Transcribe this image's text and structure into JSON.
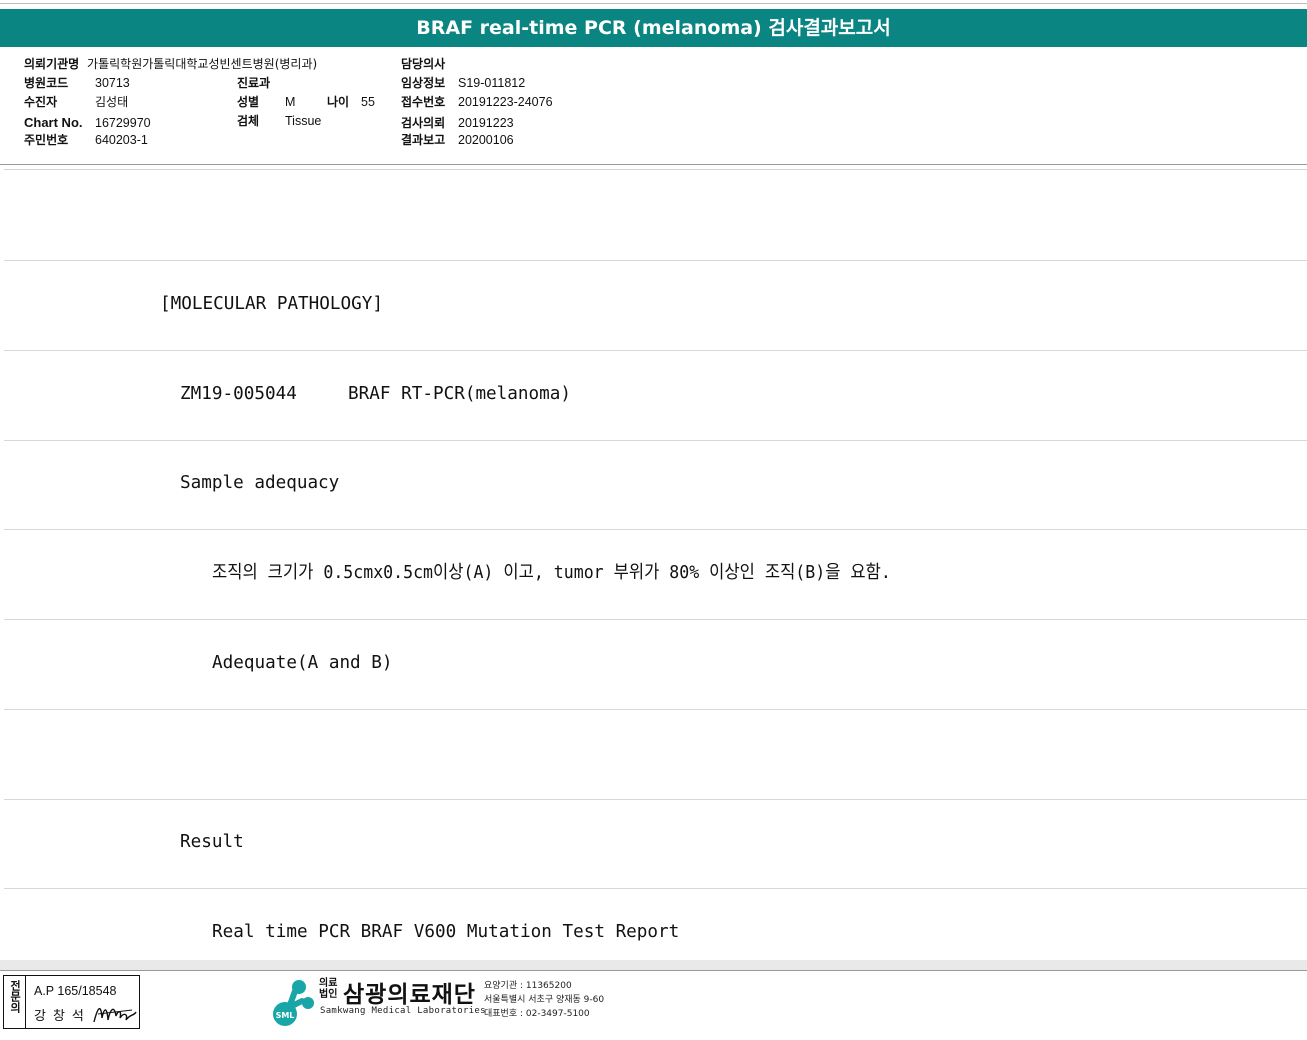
{
  "title": "BRAF real-time PCR (melanoma) 검사결과보고서",
  "header": {
    "institution_label": "의뢰기관명",
    "institution": "가톨릭학원가톨릭대학교성빈센트병원(병리과)",
    "hospital_code_label": "병원코드",
    "hospital_code": "30713",
    "patient_label": "수진자",
    "patient": "김성태",
    "chart_no_label": "Chart No.",
    "chart_no": "16729970",
    "resident_no_label": "주민번호",
    "resident_no": "640203-1",
    "department_label": "진료과",
    "department": "",
    "sex_label": "성별",
    "sex": "M",
    "age_label": "나이",
    "age": "55",
    "specimen_label": "검체",
    "specimen": "Tissue",
    "doctor_label": "담당의사",
    "doctor": "",
    "clinical_info_label": "임상정보",
    "clinical_info": "S19-011812",
    "receipt_no_label": "접수번호",
    "receipt_no": "20191223-24076",
    "request_date_label": "검사의뢰",
    "request_date": "20191223",
    "report_date_label": "결과보고",
    "report_date": "20200106"
  },
  "body": {
    "section": "[MOLECULAR PATHOLOGY]",
    "case_id": "ZM19-005044",
    "test_name": "BRAF RT-PCR(melanoma)",
    "adequacy_heading": "Sample adequacy",
    "adequacy_criteria": "조직의 크기가 0.5cmx0.5cm이상(A) 이고, tumor 부위가 80% 이상인 조직(B)을 요함.",
    "adequacy_result": "Adequate(A and B)",
    "result_heading": "Result",
    "result_title": "Real time PCR BRAF V600 Mutation Test Report"
  },
  "footer": {
    "stamp_side": "전문의",
    "stamp_line1": "A.P 165/18548",
    "stamp_line2": "강창석",
    "logo_text": "SML",
    "org_prefix_1": "의료",
    "org_prefix_2": "법인",
    "org_name": "삼광의료재단",
    "org_name_en": "Samkwang Medical Laboratories",
    "org_code": "요양기관 : 11365200",
    "org_address": "서울특별시 서초구 양재동 9-60",
    "org_phone": "대표번호 : 02-3497-5100"
  },
  "colors": {
    "title_bar": "#0a8582",
    "logo": "#19a6a6"
  }
}
